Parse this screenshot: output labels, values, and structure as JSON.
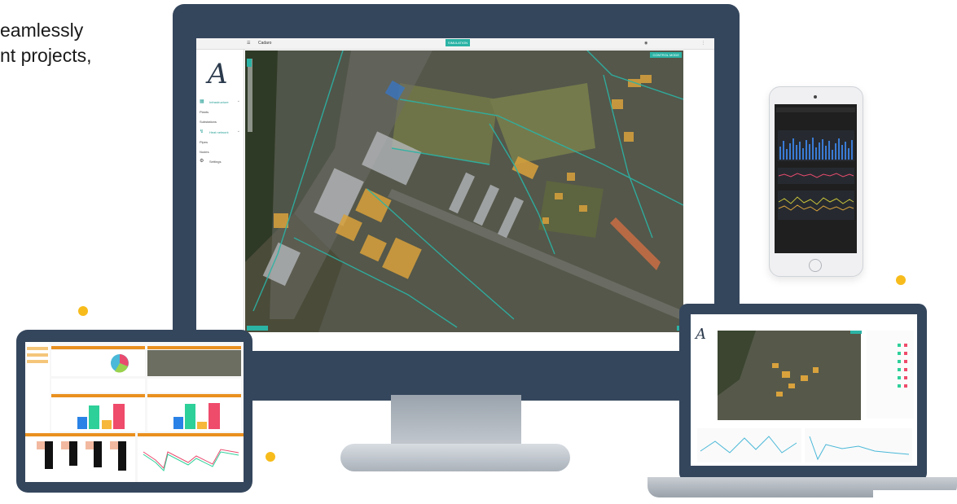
{
  "headline": {
    "line1": "eamlessly",
    "line2": "nt projects,"
  },
  "desktop_app": {
    "title": "Cadaro",
    "simulation_button": "SIMULATION",
    "map_badge": "CONTROL MODE",
    "sidebar": {
      "items": [
        {
          "label": "Infrastructure",
          "icon": "grid-icon"
        },
        {
          "label": "Plants"
        },
        {
          "label": "Substations"
        },
        {
          "label": "Heat network",
          "icon": "network-icon"
        },
        {
          "label": "Pipes"
        },
        {
          "label": "Nodes"
        },
        {
          "label": "Settings",
          "icon": "gear-icon"
        }
      ],
      "footer_button": "Exit"
    }
  },
  "colors": {
    "frame": "#34465c",
    "accent_teal": "#2bb3a5",
    "accent_orange": "#e86b25",
    "dot_yellow": "#f7bc1c",
    "building_orange": "#d9a23c"
  }
}
